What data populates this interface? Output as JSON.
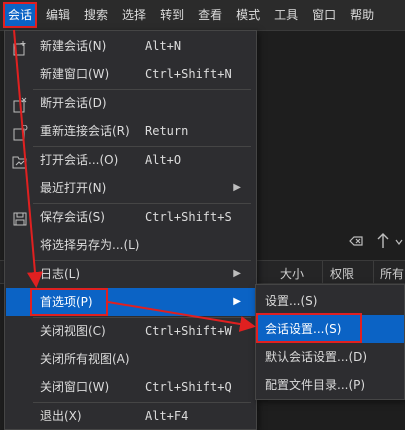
{
  "menubar": {
    "items": [
      {
        "label": "会话",
        "active": true
      },
      {
        "label": "编辑"
      },
      {
        "label": "搜索"
      },
      {
        "label": "选择"
      },
      {
        "label": "转到"
      },
      {
        "label": "查看"
      },
      {
        "label": "模式"
      },
      {
        "label": "工具"
      },
      {
        "label": "窗口"
      },
      {
        "label": "帮助"
      }
    ]
  },
  "background": {
    "columns": [
      "大小",
      "权限",
      "所有"
    ],
    "tool_icons": [
      "eraser-icon",
      "arrow-up-icon",
      "chevron-down-icon"
    ]
  },
  "session_menu": {
    "items": [
      {
        "label": "新建会话(N)",
        "shortcut": "Alt+N",
        "icon": "new-session-icon"
      },
      {
        "label": "新建窗口(W)",
        "shortcut": "Ctrl+Shift+N"
      },
      {
        "label": "断开会话(D)",
        "icon": "disconnect-icon"
      },
      {
        "label": "重新连接会话(R)",
        "shortcut": "Return",
        "icon": "reconnect-icon"
      },
      {
        "label": "打开会话...(O)",
        "shortcut": "Alt+O",
        "icon": "open-session-icon"
      },
      {
        "label": "最近打开(N)",
        "submenu": true
      },
      {
        "label": "保存会话(S)",
        "shortcut": "Ctrl+Shift+S",
        "icon": "save-icon"
      },
      {
        "label": "将选择另存为...(L)"
      },
      {
        "label": "日志(L)",
        "submenu": true
      },
      {
        "label": "首选项(P)",
        "submenu": true,
        "highlighted": true
      },
      {
        "label": "关闭视图(C)",
        "shortcut": "Ctrl+Shift+W"
      },
      {
        "label": "关闭所有视图(A)"
      },
      {
        "label": "关闭窗口(W)",
        "shortcut": "Ctrl+Shift+Q"
      },
      {
        "label": "退出(X)",
        "shortcut": "Alt+F4"
      }
    ]
  },
  "preferences_submenu": {
    "items": [
      {
        "label": "设置...(S)"
      },
      {
        "label": "会话设置...(S)",
        "highlighted": true
      },
      {
        "label": "默认会话设置...(D)"
      },
      {
        "label": "配置文件目录...(P)"
      }
    ]
  },
  "colors": {
    "highlight": "#0b63c5",
    "annotation": "#e02020",
    "menu_bg": "#2d2d30"
  }
}
